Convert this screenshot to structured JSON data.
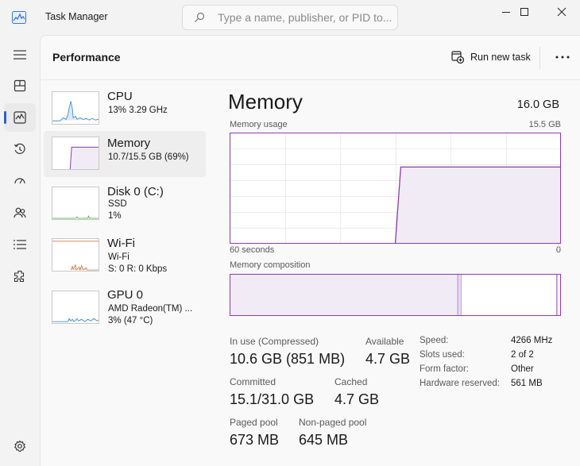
{
  "window": {
    "title": "Task Manager",
    "search_placeholder": "Type a name, publisher, or PID to..."
  },
  "nav": {
    "items": [
      {
        "name": "menu",
        "icon": "hamburger-icon"
      },
      {
        "name": "processes",
        "icon": "processes-icon"
      },
      {
        "name": "performance",
        "icon": "performance-icon",
        "active": true
      },
      {
        "name": "app-history",
        "icon": "history-icon"
      },
      {
        "name": "startup-apps",
        "icon": "startup-icon"
      },
      {
        "name": "users",
        "icon": "users-icon"
      },
      {
        "name": "details",
        "icon": "details-icon"
      },
      {
        "name": "services",
        "icon": "services-icon"
      },
      {
        "name": "settings",
        "icon": "gear-icon"
      }
    ]
  },
  "header": {
    "title": "Performance",
    "run_task_label": "Run new task",
    "more_label": "..."
  },
  "devices": [
    {
      "name": "CPU",
      "line2": "13%  3.29 GHz",
      "line3": ""
    },
    {
      "name": "Memory",
      "line2": "10.7/15.5 GB (69%)",
      "line3": "",
      "active": true
    },
    {
      "name": "Disk 0 (C:)",
      "line2": "SSD",
      "line3": "1%"
    },
    {
      "name": "Wi-Fi",
      "line2": "Wi-Fi",
      "line3": "S: 0  R: 0 Kbps"
    },
    {
      "name": "GPU 0",
      "line2": "AMD Radeon(TM) ...",
      "line3": "3%  (47 °C)"
    }
  ],
  "memory": {
    "title": "Memory",
    "total": "16.0 GB",
    "usage_label": "Memory usage",
    "usage_max": "15.5 GB",
    "time_left": "60 seconds",
    "time_right": "0",
    "composition_label": "Memory composition",
    "stats": {
      "in_use_label": "In use (Compressed)",
      "in_use_value": "10.6 GB (851 MB)",
      "available_label": "Available",
      "available_value": "4.7 GB",
      "committed_label": "Committed",
      "committed_value": "15.1/31.0 GB",
      "cached_label": "Cached",
      "cached_value": "4.7 GB",
      "paged_label": "Paged pool",
      "paged_value": "673 MB",
      "nonpaged_label": "Non-paged pool",
      "nonpaged_value": "645 MB"
    },
    "specs": [
      {
        "key": "Speed:",
        "value": "4266 MHz"
      },
      {
        "key": "Slots used:",
        "value": "2 of 2"
      },
      {
        "key": "Form factor:",
        "value": "Other"
      },
      {
        "key": "Hardware reserved:",
        "value": "561 MB"
      }
    ],
    "usage_history_fraction": [
      0,
      0,
      0,
      0,
      0,
      0,
      0,
      0,
      0,
      0,
      0,
      0,
      0,
      0,
      0,
      0,
      0,
      0,
      0,
      0,
      0,
      0,
      0,
      0,
      0,
      0,
      0,
      0,
      0,
      0,
      0,
      0.69,
      0.69,
      0.69,
      0.69,
      0.69,
      0.69,
      0.69,
      0.69,
      0.69,
      0.69,
      0.69,
      0.69,
      0.69,
      0.69,
      0.69,
      0.69,
      0.69,
      0.69,
      0.69,
      0.69,
      0.69,
      0.69,
      0.69,
      0.69,
      0.69,
      0.69,
      0.69,
      0.69,
      0.69,
      0.69
    ],
    "composition_fraction": {
      "in_use": 0.69,
      "modified": 0.01,
      "standby": 0.29,
      "free": 0.01
    }
  },
  "colors": {
    "accent": "#2c63c9",
    "memory_line": "#8a3bb5",
    "memory_fill": "#f1ebf5",
    "cpu_line": "#2a82c7",
    "wifi_line": "#c86a28"
  }
}
